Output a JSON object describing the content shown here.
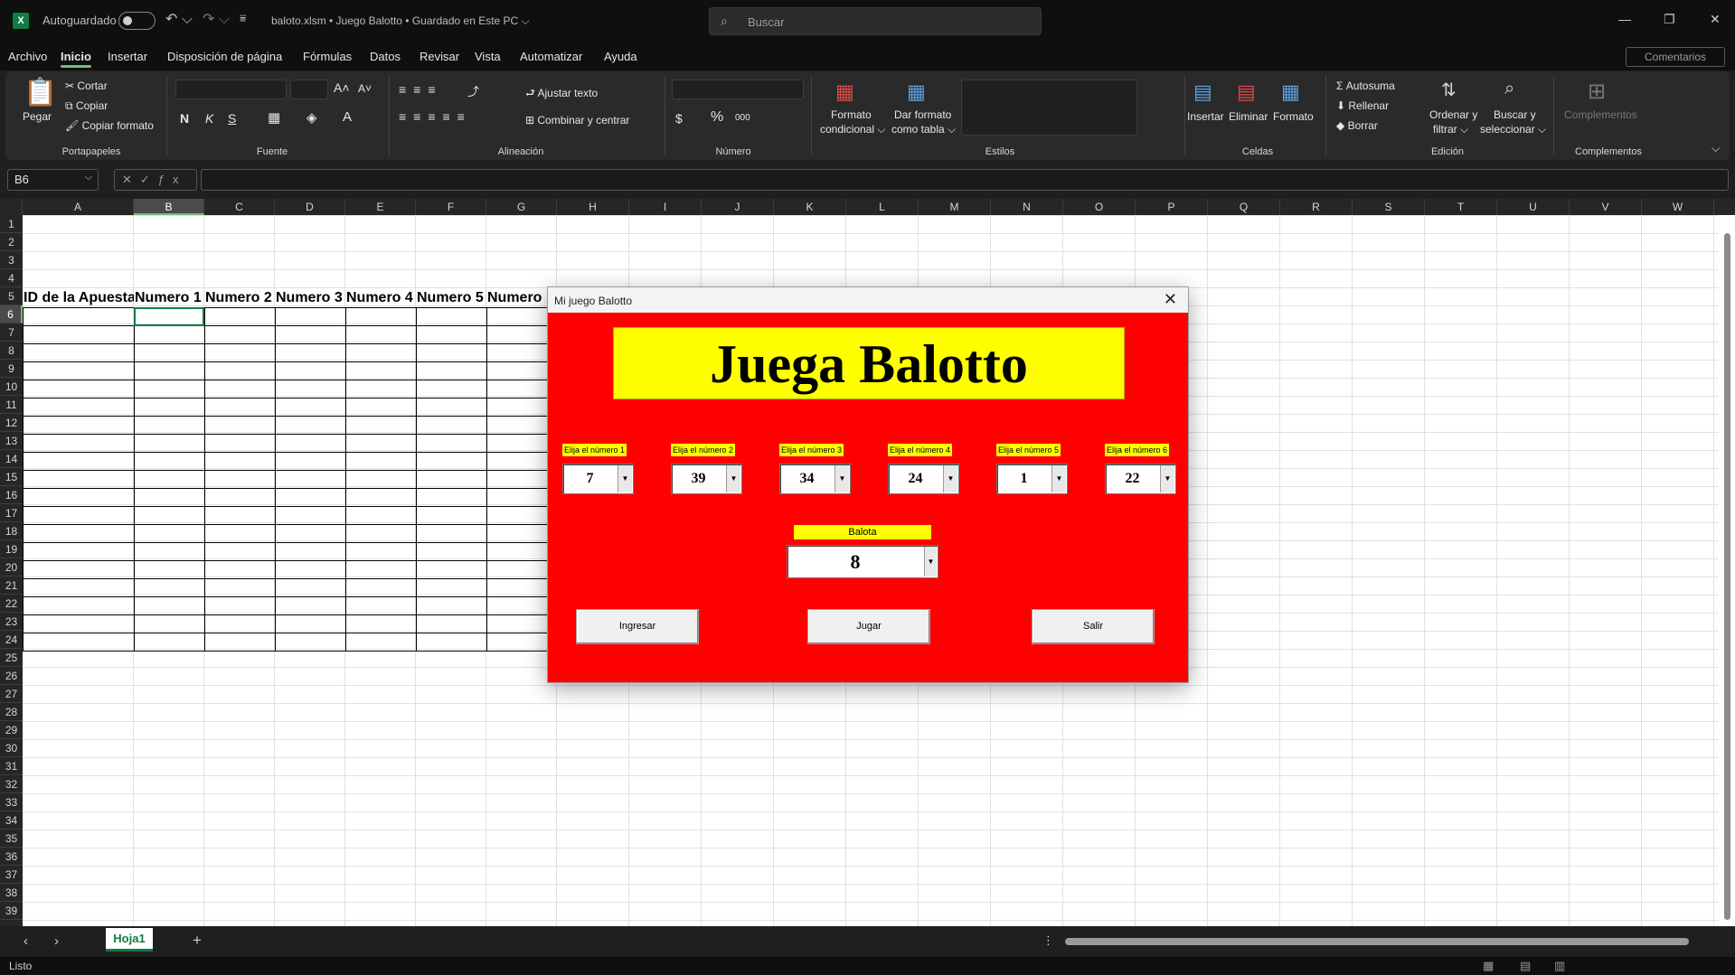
{
  "titlebar": {
    "app_icon": "X",
    "autosave_label": "Autoguardado",
    "file_label": "baloto.xlsm  •  Juego Balotto  •  Guardado en Este PC  ⌵",
    "search_placeholder": "Buscar",
    "icons": [
      "excel-icon",
      "undo-icon",
      "redo-icon",
      "search-icon",
      "minimize-icon",
      "maximize-icon",
      "close-icon"
    ]
  },
  "menu": {
    "tabs": [
      "Archivo",
      "Inicio",
      "Insertar",
      "Disposición de página",
      "Fórmulas",
      "Datos",
      "Revisar",
      "Vista",
      "Automatizar",
      "Ayuda"
    ],
    "active": "Inicio",
    "comments": "Comentarios"
  },
  "ribbon": {
    "paste": "Pegar",
    "cut": "Cortar",
    "copy": "Copiar",
    "format_painter": "Copiar formato",
    "bold": "N",
    "italic": "K",
    "underline": "S",
    "wrap_text": "Ajustar texto",
    "merge_center": "Combinar y centrar",
    "cond_format_1": "Formato",
    "cond_format_2": "condicional ⌵",
    "table_format_1": "Dar formato",
    "table_format_2": "como tabla ⌵",
    "insert": "Insertar",
    "delete": "Eliminar",
    "format": "Formato",
    "autosum": "Autosuma",
    "fill": "Rellenar",
    "clear": "Borrar",
    "sort_1": "Ordenar y",
    "sort_2": "filtrar ⌵",
    "find_1": "Buscar y",
    "find_2": "seleccionar ⌵",
    "addins": "Complementos",
    "groups": {
      "clipboard": "Portapapeles",
      "font": "Fuente",
      "alignment": "Alineación",
      "number": "Número",
      "styles": "Estilos",
      "cells": "Celdas",
      "editing": "Edición",
      "addins": "Complementos"
    }
  },
  "formula_bar": {
    "name_box": "B6",
    "formula": ""
  },
  "sheet": {
    "columns": [
      "A",
      "B",
      "C",
      "D",
      "E",
      "F",
      "G",
      "H",
      "I",
      "J",
      "K",
      "L",
      "M",
      "N",
      "O",
      "P",
      "Q",
      "R",
      "S",
      "T",
      "U",
      "V",
      "W"
    ],
    "rows": [
      "1",
      "2",
      "3",
      "4",
      "5",
      "6",
      "7",
      "8",
      "9",
      "10",
      "11",
      "12",
      "13",
      "14",
      "15",
      "16",
      "17",
      "18",
      "19",
      "20",
      "21",
      "22",
      "23",
      "24",
      "25",
      "26",
      "27",
      "28",
      "29",
      "30",
      "31",
      "32",
      "33",
      "34",
      "35",
      "36",
      "37",
      "38",
      "39"
    ],
    "headers": [
      "ID de la Apuesta",
      "Numero 1",
      "Numero 2",
      "Numero 3",
      "Numero 4",
      "Numero 5",
      "Numero"
    ],
    "selected_cell": "B6",
    "tab": "Hoja1",
    "status": "Listo"
  },
  "dialog": {
    "title": "Mi juego Balotto",
    "banner": "Juega Balotto",
    "labels": [
      "Elija el número 1",
      "Elija el número 2",
      "Elija el número 3",
      "Elija el número 4",
      "Elija el número 5",
      "Elija el número 6"
    ],
    "values": [
      "7",
      "39",
      "34",
      "24",
      "1",
      "22"
    ],
    "balota_label": "Balota",
    "balota_value": "8",
    "buttons": {
      "ingresar": "Ingresar",
      "jugar": "Jugar",
      "salir": "Salir"
    },
    "colors": {
      "background": "#ff0000",
      "highlight": "#ffff00"
    }
  }
}
